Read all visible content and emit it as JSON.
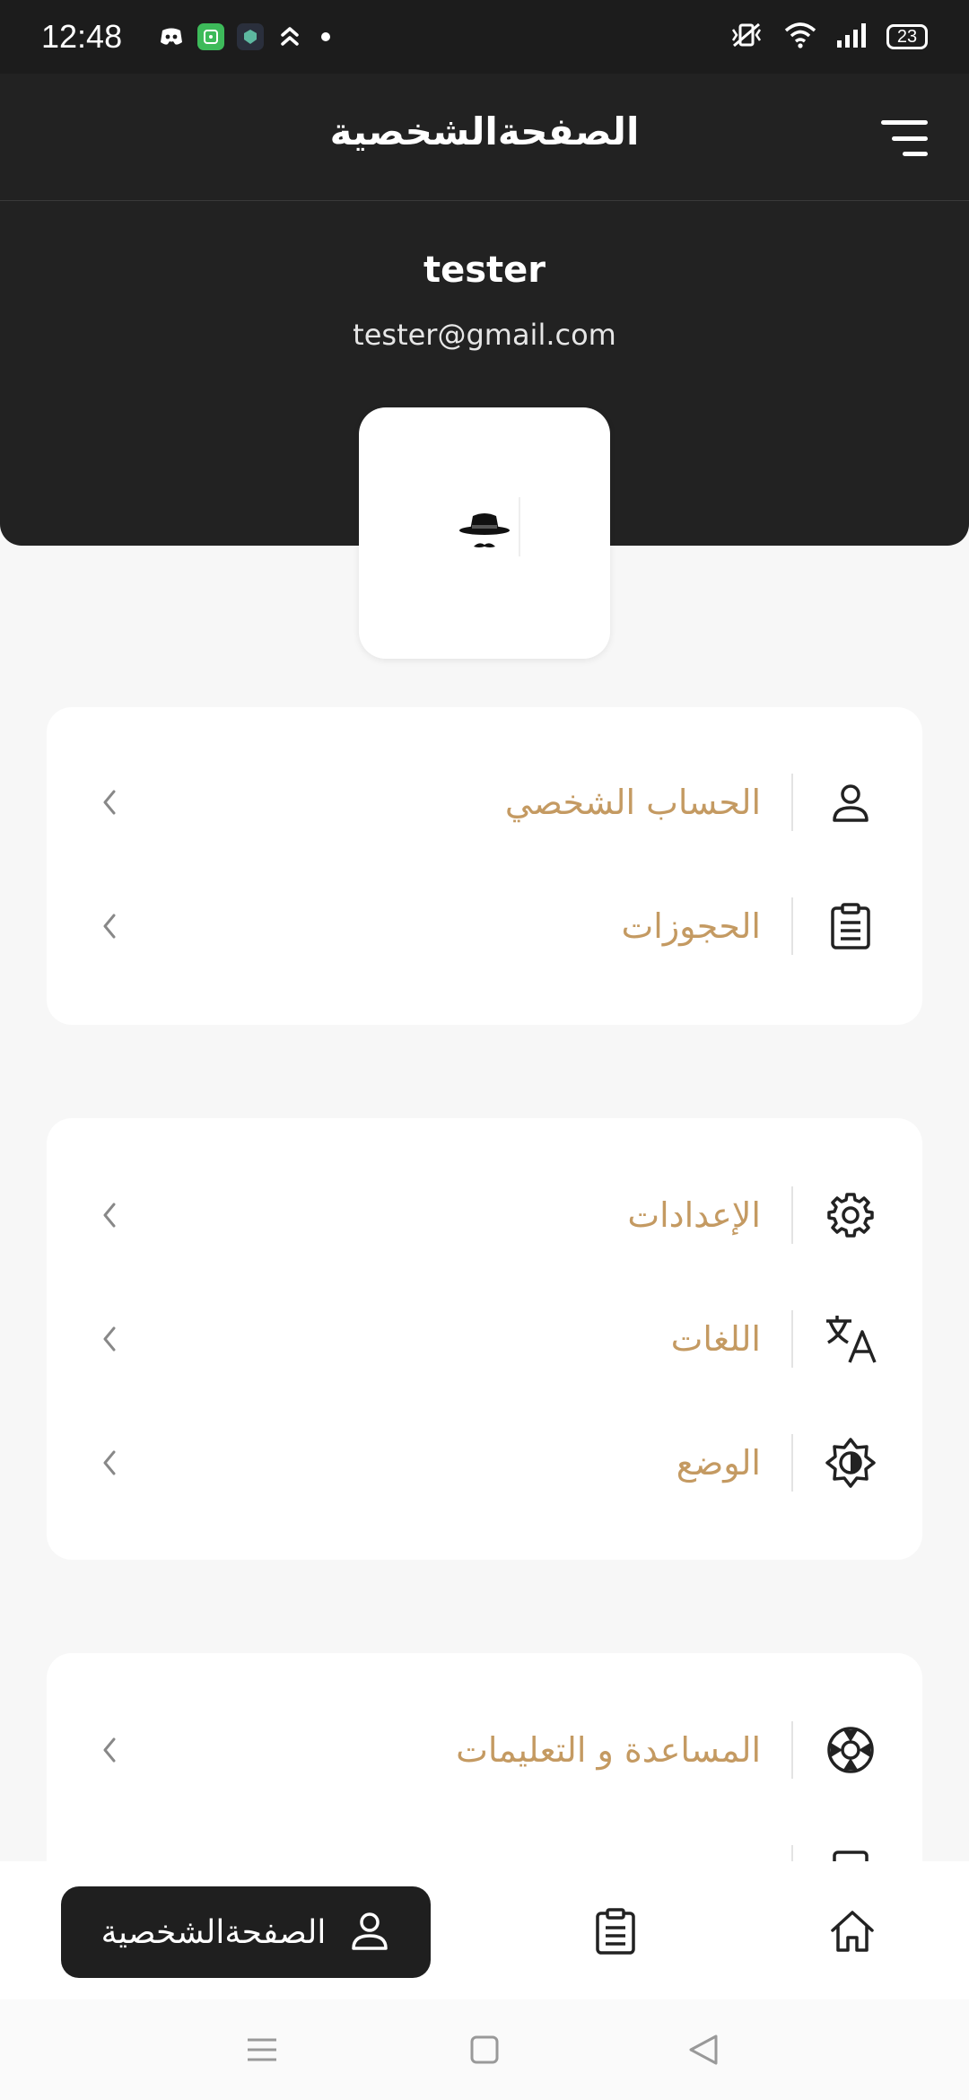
{
  "status_bar": {
    "time": "12:48",
    "battery": "23"
  },
  "header": {
    "title": "الصفحةالشخصية"
  },
  "profile": {
    "username": "tester",
    "email": "tester@gmail.com"
  },
  "cards": [
    {
      "items": [
        {
          "label": "الحساب الشخصي",
          "icon": "user-icon"
        },
        {
          "label": "الحجوزات",
          "icon": "clipboard-icon"
        }
      ]
    },
    {
      "items": [
        {
          "label": "الإعدادات",
          "icon": "gear-icon"
        },
        {
          "label": "اللغات",
          "icon": "translate-icon"
        },
        {
          "label": "الوضع",
          "icon": "theme-icon"
        }
      ]
    },
    {
      "items": [
        {
          "label": "المساعدة و التعليمات",
          "icon": "help-icon"
        }
      ]
    }
  ],
  "bottom_nav": {
    "profile_label": "الصفحةالشخصية"
  },
  "colors": {
    "accent": "#c49a62",
    "dark": "#222222"
  }
}
